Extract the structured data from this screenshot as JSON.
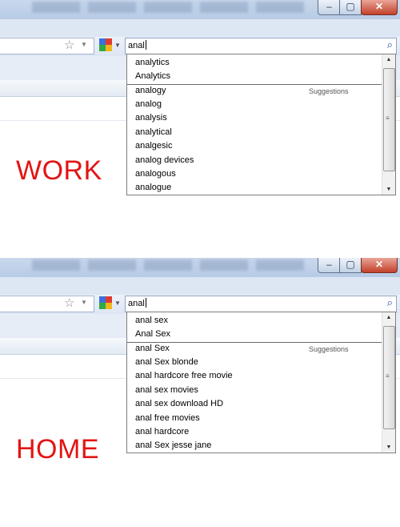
{
  "work": {
    "query": "anal",
    "history": [
      "analytics",
      "Analytics"
    ],
    "suggestions_label": "Suggestions",
    "suggestions": [
      "analogy",
      "analog",
      "analysis",
      "analytical",
      "analgesic",
      "analog devices",
      "analogous",
      "analogue"
    ],
    "caption": "WORK"
  },
  "home": {
    "query": "anal",
    "history": [
      "anal sex",
      "Anal Sex"
    ],
    "suggestions_label": "Suggestions",
    "suggestions": [
      "anal Sex",
      "anal Sex blonde",
      "anal hardcore free movie",
      "anal sex movies",
      "anal sex download HD",
      "anal free movies",
      "anal hardcore",
      "anal Sex jesse jane"
    ],
    "caption": "HOME"
  },
  "window_buttons": {
    "minimize": "–",
    "maximize": "▢",
    "close": "✕"
  },
  "icons": {
    "favorite": "star-icon",
    "search": "magnifier-icon",
    "engine": "google-logo-icon"
  },
  "colors": {
    "caption": "#e31414",
    "close_button": "#c2412a",
    "chrome": "#dde6f3"
  }
}
